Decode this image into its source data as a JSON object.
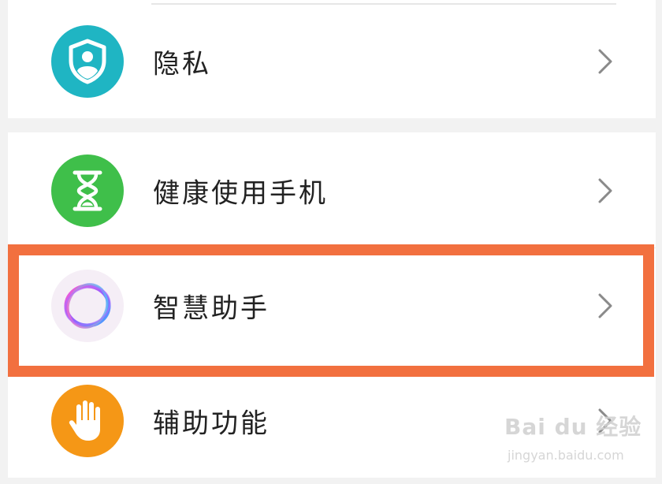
{
  "settings": {
    "items": [
      {
        "label": "隐私",
        "icon": "privacy-shield-icon",
        "color": "#1fb5c3"
      },
      {
        "label": "健康使用手机",
        "icon": "hourglass-icon",
        "color": "#3fbf4a"
      },
      {
        "label": "智慧助手",
        "icon": "smart-assistant-ring-icon",
        "color": "#f5eef6"
      },
      {
        "label": "辅助功能",
        "icon": "hand-icon",
        "color": "#f59716"
      }
    ]
  },
  "highlight": {
    "color": "#f2703f"
  },
  "watermark": {
    "brand": "Bai du 经验",
    "url": "jingyan.baidu.com"
  }
}
